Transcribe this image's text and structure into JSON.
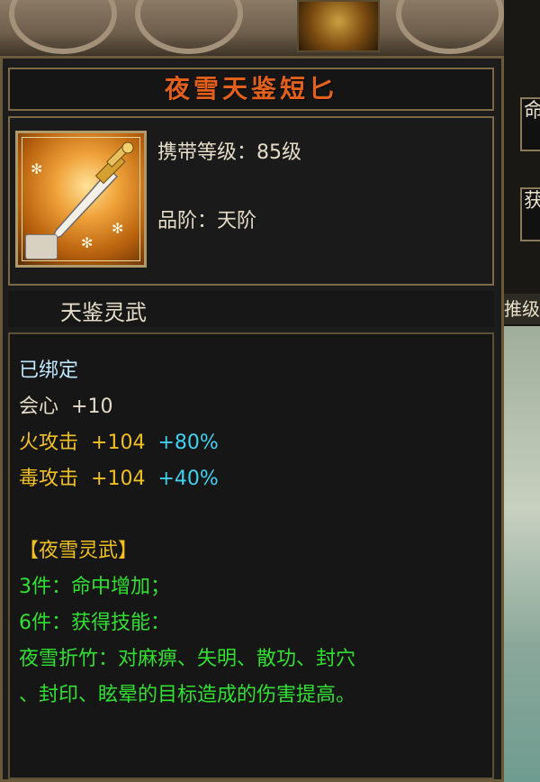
{
  "item": {
    "name": "夜雪天鉴短匕",
    "carry_level_label": "携带等级：",
    "carry_level_value": "85级",
    "grade_label": "品阶：",
    "grade_value": "天阶",
    "set_name": "天鉴灵武",
    "icon": "dagger-icon"
  },
  "attributes": {
    "bound": "已绑定",
    "crit_label": "会心",
    "crit_value": "+10",
    "fire_label": "火攻击",
    "fire_value": "+104",
    "fire_pct": "+80%",
    "poison_label": "毒攻击",
    "poison_value": "+104",
    "poison_pct": "+40%"
  },
  "set_bonus": {
    "title": "【夜雪灵武】",
    "three_piece": "3件：命中增加；",
    "six_piece": "6件：获得技能：",
    "skill_line1": "夜雪折竹：对麻痹、失明、散功、封穴",
    "skill_line2": "、封印、眩晕的目标造成的伤害提高。"
  },
  "background": {
    "right_slot_1": "命",
    "right_slot_2": "获",
    "right_tag": "推级"
  },
  "colors": {
    "title": "#e2601c",
    "bound": "#bfe8ff",
    "yellow": "#f0c020",
    "cyan": "#40d0f0",
    "green": "#30e030"
  }
}
